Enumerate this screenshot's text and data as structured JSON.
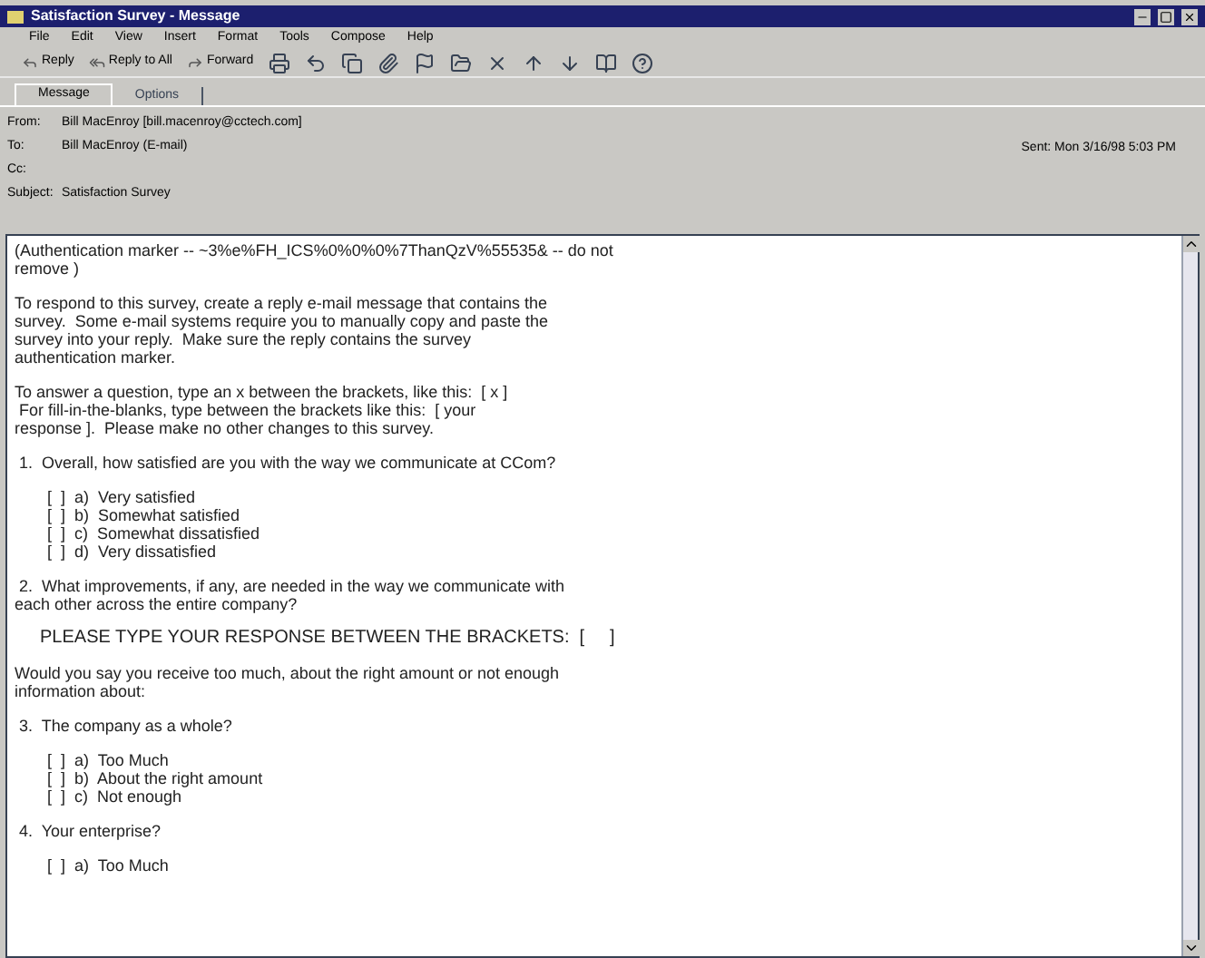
{
  "window": {
    "title": "Satisfaction Survey - Message"
  },
  "menu": [
    "File",
    "Edit",
    "View",
    "Insert",
    "Format",
    "Tools",
    "Compose",
    "Help"
  ],
  "toolbar": [
    "Reply",
    "Reply to All",
    "Forward"
  ],
  "tabs": [
    {
      "label": "Message",
      "selected": true
    },
    {
      "label": "Options",
      "selected": false
    }
  ],
  "header": {
    "fields": [
      {
        "label": "From:",
        "value": "Bill MacEnroy [bill.macenroy@cctech.com]"
      },
      {
        "label": "To:",
        "value": "Bill MacEnroy (E-mail)"
      },
      {
        "label": "Cc:"
      },
      {
        "label": "Subject:",
        "value": "Satisfaction Survey"
      }
    ],
    "sent": "Sent:  Mon 3/16/98 5:03 PM"
  },
  "body": [
    {
      "kind": "text",
      "lines": [
        "(Authentication marker -- ~3%e%FH_ICS%0%0%0%7ThanQzV%55535& -- do not",
        "remove )"
      ]
    },
    {
      "kind": "text",
      "lines": [
        "To respond to this survey, create a reply e-mail message that contains the",
        "survey.  Some e-mail systems require you to manually copy and paste the",
        "survey into your reply.  Make sure the reply contains the survey",
        "authentication marker."
      ]
    },
    {
      "kind": "text",
      "lines": [
        "To answer a question, type an x between the brackets, like this:  [ x ]",
        " For fill-in-the-blanks, type between the brackets like this:  [ your",
        "response ].  Please make no other changes to this survey."
      ]
    },
    {
      "kind": "text",
      "lines": [
        " 1.  Overall, how satisfied are you with the way we communicate at CCom?"
      ]
    },
    {
      "kind": "options",
      "lines": [
        "[  ]  a)  Very satisfied",
        "[  ]  b)  Somewhat satisfied",
        "[  ]  c)  Somewhat dissatisfied",
        "[  ]  d)  Very dissatisfied"
      ]
    },
    {
      "kind": "text",
      "lines": [
        " 2.  What improvements, if any, are needed in the way we communicate with",
        "each other across the entire company?"
      ]
    },
    {
      "kind": "prompt",
      "lines": [
        "PLEASE TYPE YOUR RESPONSE BETWEEN THE BRACKETS:  [     ]"
      ]
    },
    {
      "kind": "text",
      "lines": [
        "Would you say you receive too much, about the right amount or not enough",
        "information about:"
      ]
    },
    {
      "kind": "text",
      "lines": [
        " 3.  The company as a whole?"
      ]
    },
    {
      "kind": "options",
      "lines": [
        "[  ]  a)  Too Much",
        "[  ]  b)  About the right amount",
        "[  ]  c)  Not enough"
      ]
    },
    {
      "kind": "text",
      "lines": [
        " 4.  Your enterprise?"
      ]
    },
    {
      "kind": "options",
      "lines": [
        "[  ]  a)  Too Much"
      ]
    }
  ]
}
